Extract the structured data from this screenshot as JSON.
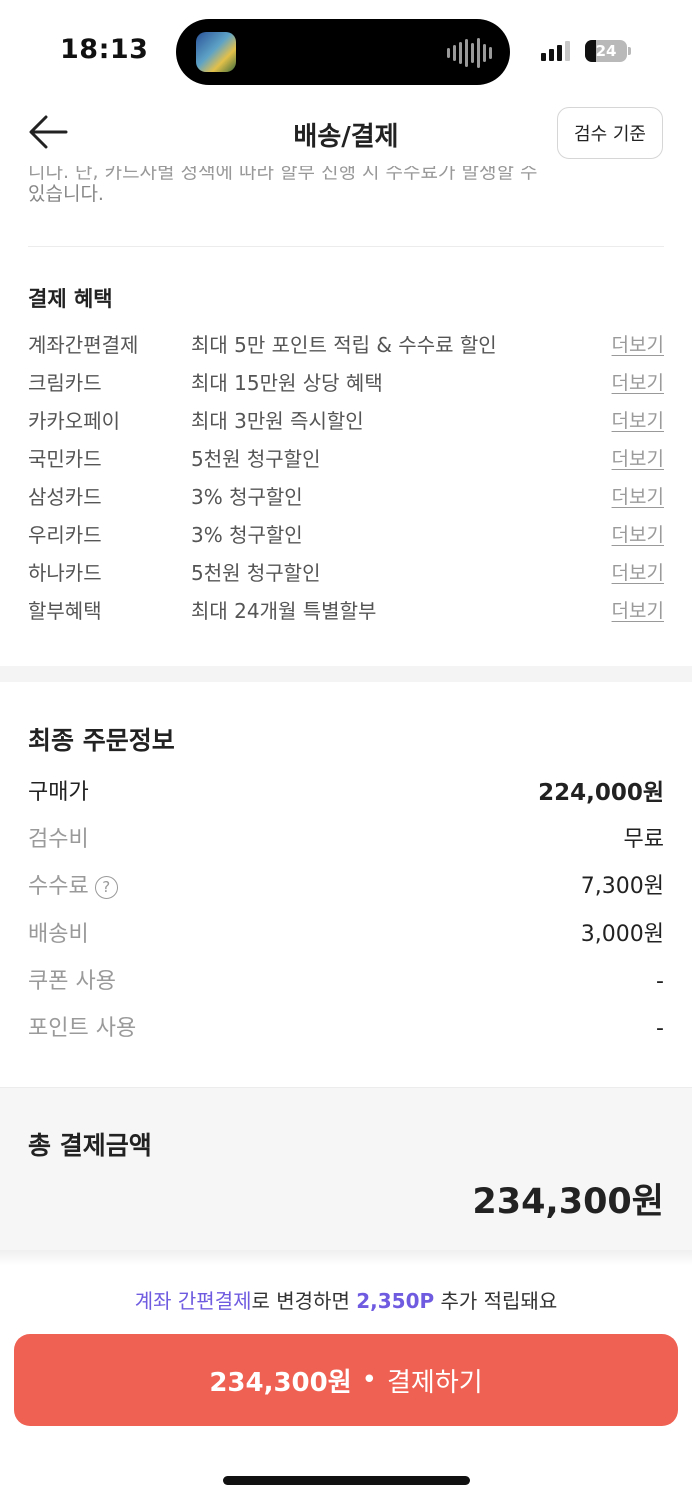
{
  "status_bar": {
    "time": "18:13",
    "battery": "24"
  },
  "header": {
    "title": "배송/결제",
    "criteria_button": "검수 기준"
  },
  "notice": {
    "line1": "니다. 단, 카드사별 정책에 따라 할부 진행 시 수수료가 발생할 수",
    "line2": "있습니다."
  },
  "benefits": {
    "title": "결제 혜택",
    "more_label": "더보기",
    "items": [
      {
        "name": "계좌간편결제",
        "desc": "최대 5만 포인트 적립 & 수수료 할인"
      },
      {
        "name": "크림카드",
        "desc": "최대 15만원 상당 혜택"
      },
      {
        "name": "카카오페이",
        "desc": "최대 3만원 즉시할인"
      },
      {
        "name": "국민카드",
        "desc": "5천원 청구할인"
      },
      {
        "name": "삼성카드",
        "desc": "3% 청구할인"
      },
      {
        "name": "우리카드",
        "desc": "3% 청구할인"
      },
      {
        "name": "하나카드",
        "desc": "5천원 청구할인"
      },
      {
        "name": "할부혜택",
        "desc": "최대 24개월 특별할부"
      }
    ]
  },
  "order": {
    "title": "최종 주문정보",
    "rows": [
      {
        "label": "구매가",
        "value": "224,000원"
      },
      {
        "label": "검수비",
        "value": "무료"
      },
      {
        "label": "수수료",
        "value": "7,300원"
      },
      {
        "label": "배송비",
        "value": "3,000원"
      },
      {
        "label": "쿠폰 사용",
        "value": "-"
      },
      {
        "label": "포인트 사용",
        "value": "-"
      }
    ],
    "help_icon": "?"
  },
  "total": {
    "label": "총 결제금액",
    "amount": "234,300원"
  },
  "promo": {
    "method": "계좌 간편결제",
    "middle": "로 변경하면 ",
    "points": "2,350P",
    "suffix": " 추가 적립돼요"
  },
  "pay_button": {
    "amount": "234,300원",
    "separator": "•",
    "action": "결제하기"
  },
  "colors": {
    "accent": "#6e5be0",
    "pay_button": "#ef6253"
  }
}
